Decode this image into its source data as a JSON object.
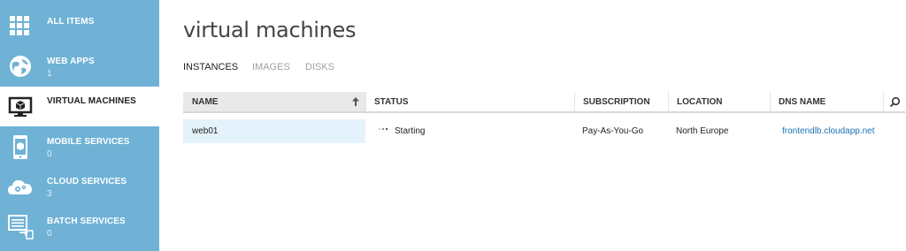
{
  "sidebar": {
    "items": [
      {
        "label": "ALL ITEMS",
        "count": "",
        "icon": "grid-icon",
        "active": false
      },
      {
        "label": "WEB APPS",
        "count": "1",
        "icon": "globe-icon",
        "active": false
      },
      {
        "label": "VIRTUAL MACHINES",
        "count": "",
        "icon": "virtual-machine-icon",
        "active": true
      },
      {
        "label": "MOBILE SERVICES",
        "count": "0",
        "icon": "mobile-device-icon",
        "active": false
      },
      {
        "label": "CLOUD SERVICES",
        "count": "3",
        "icon": "cloud-gear-icon",
        "active": false
      },
      {
        "label": "BATCH SERVICES",
        "count": "0",
        "icon": "batch-list-icon",
        "active": false
      }
    ]
  },
  "main": {
    "title": "virtual machines",
    "tabs": [
      {
        "label": "INSTANCES",
        "active": true
      },
      {
        "label": "IMAGES",
        "active": false
      },
      {
        "label": "DISKS",
        "active": false
      }
    ],
    "table": {
      "columns": [
        "NAME",
        "STATUS",
        "SUBSCRIPTION",
        "LOCATION",
        "DNS NAME"
      ],
      "sort_icon": "sort-ascending-arrow-icon",
      "search_icon": "search-icon",
      "rows": [
        {
          "name": "web01",
          "status": "Starting",
          "subscription": "Pay-As-You-Go",
          "location": "North Europe",
          "dns_name": "frontendlb.cloudapp.net"
        }
      ]
    }
  },
  "colors": {
    "sidebar_bg": "#6fb2d6",
    "selected_row": "#e4f3fb",
    "link": "#1a73b5"
  }
}
